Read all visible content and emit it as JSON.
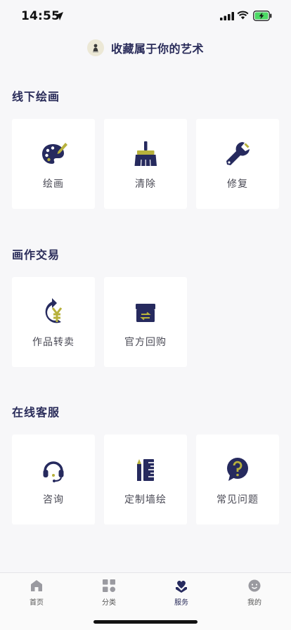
{
  "status_bar": {
    "time": "14:55"
  },
  "header": {
    "title": "收藏属于你的艺术"
  },
  "sections": [
    {
      "title": "线下绘画",
      "items": [
        {
          "label": "绘画",
          "icon": "palette-icon"
        },
        {
          "label": "清除",
          "icon": "broom-icon"
        },
        {
          "label": "修复",
          "icon": "wrench-icon"
        }
      ]
    },
    {
      "title": "画作交易",
      "items": [
        {
          "label": "作品转卖",
          "icon": "resell-yen-icon"
        },
        {
          "label": "官方回购",
          "icon": "buyback-box-icon"
        }
      ]
    },
    {
      "title": "在线客服",
      "items": [
        {
          "label": "咨询",
          "icon": "headset-icon"
        },
        {
          "label": "定制墙绘",
          "icon": "ruler-pencil-icon"
        },
        {
          "label": "常见问题",
          "icon": "question-bubble-icon"
        }
      ]
    }
  ],
  "tabbar": {
    "tabs": [
      {
        "label": "首页",
        "icon": "home-icon"
      },
      {
        "label": "分类",
        "icon": "category-icon"
      },
      {
        "label": "服务",
        "icon": "service-icon",
        "active": true
      },
      {
        "label": "我的",
        "icon": "profile-icon"
      }
    ]
  },
  "colors": {
    "primary": "#2a2c5a",
    "accent": "#b7b13c",
    "background": "#f7f7f9",
    "battery": "#4cd964"
  }
}
